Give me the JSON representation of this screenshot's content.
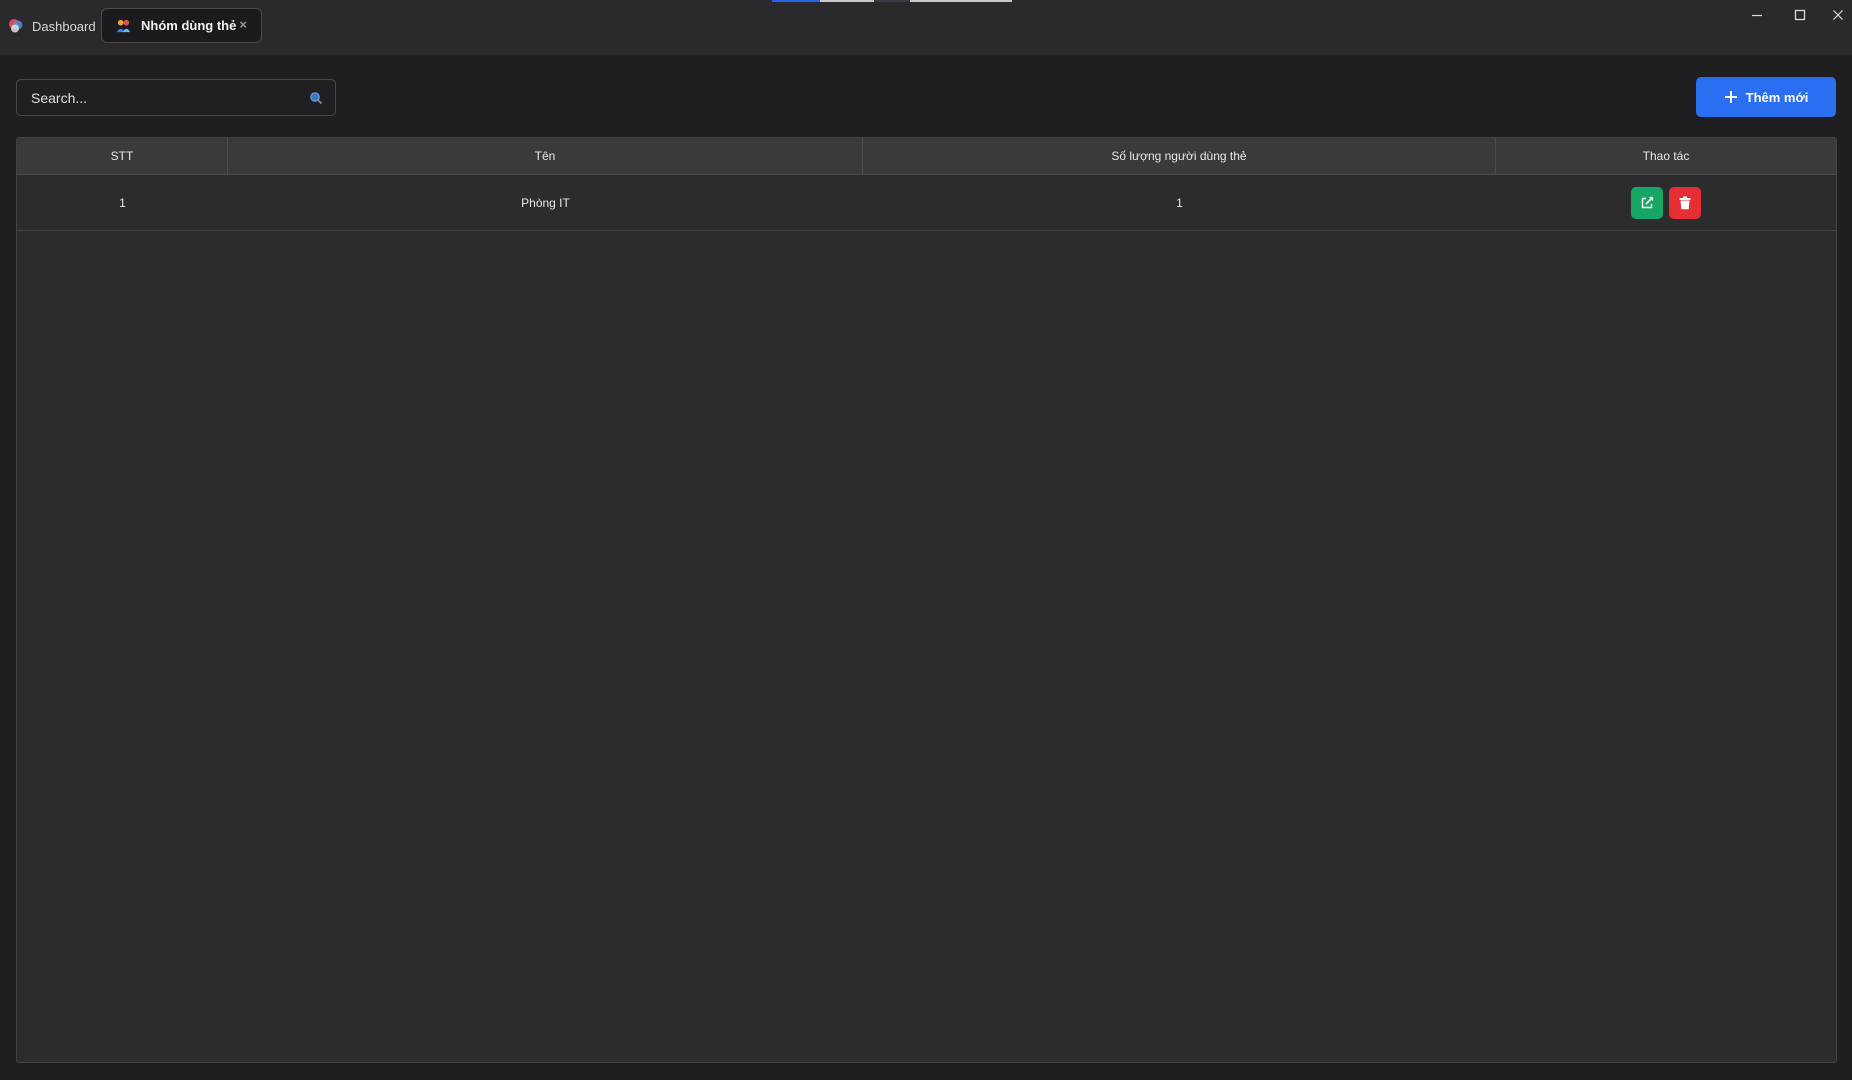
{
  "window": {
    "tabs": [
      {
        "label": "Dashboard",
        "icon": "app-logo-icon",
        "active": false
      },
      {
        "label": "Nhóm dùng thẻ",
        "icon": "user-group-icon",
        "active": true,
        "close_glyph": "×"
      }
    ],
    "controls": [
      "minimize-icon",
      "maximize-icon",
      "close-icon"
    ]
  },
  "toolbar": {
    "search_placeholder": "Search...",
    "search_value": "",
    "add_button_label": "Thêm mới",
    "add_button_color": "#2a6ff2"
  },
  "table": {
    "columns": [
      "STT",
      "Tên",
      "Số lượng người dùng thẻ",
      "Thao tác"
    ],
    "rows": [
      {
        "stt": "1",
        "name": "Phòng IT",
        "count": "1",
        "actions": [
          "edit-icon",
          "trash-icon"
        ]
      }
    ]
  },
  "colors": {
    "edit": "#17a765",
    "delete": "#e52f35",
    "background": "#1f1f21",
    "panel": "#2c2c2e"
  }
}
